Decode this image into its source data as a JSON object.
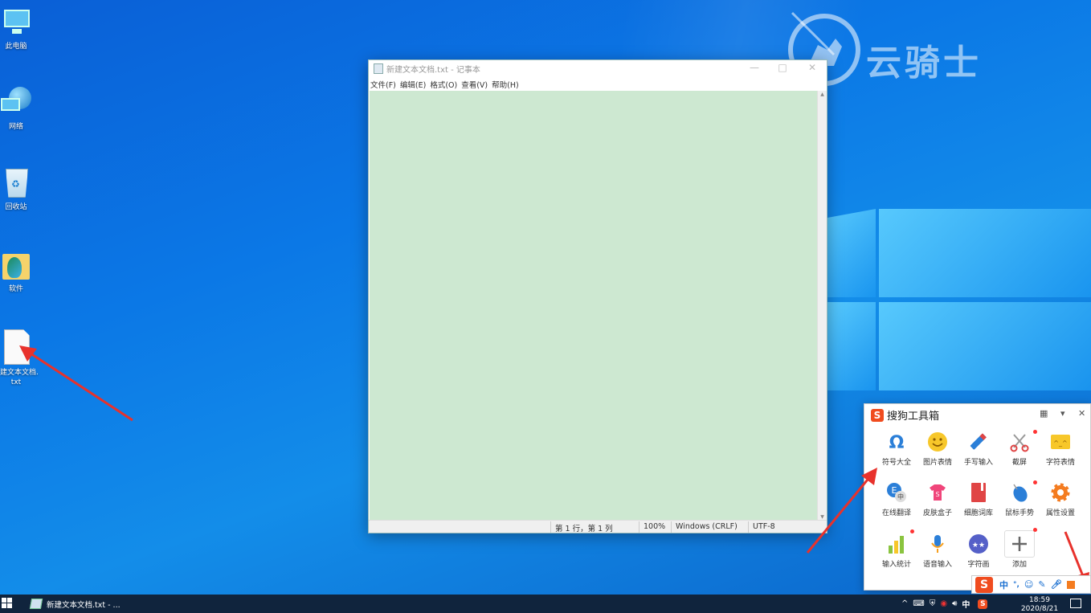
{
  "desktop": {
    "icons": [
      {
        "label": "此电脑"
      },
      {
        "label": "网络"
      },
      {
        "label": "回收站"
      },
      {
        "label": "软件"
      },
      {
        "label_line1": "建文本文档.",
        "label_line2": "txt"
      }
    ]
  },
  "watermark": {
    "text": "云骑士"
  },
  "notepad": {
    "title": "新建文本文档.txt - 记事本",
    "menu": [
      "文件(F)",
      "编辑(E)",
      "格式(O)",
      "查看(V)",
      "帮助(H)"
    ],
    "status": {
      "position": "第 1 行，第 1 列",
      "zoom": "100%",
      "line_ending": "Windows (CRLF)",
      "encoding": "UTF-8"
    },
    "editor_bg": "#cde8d1"
  },
  "toolbox": {
    "title": "搜狗工具箱",
    "items": [
      {
        "label": "符号大全",
        "icon": "omega-icon",
        "color": "#2b7fd8"
      },
      {
        "label": "图片表情",
        "icon": "smiley-icon",
        "color": "#f7c72a"
      },
      {
        "label": "手写输入",
        "icon": "pen-icon",
        "color": "#2b7fd8"
      },
      {
        "label": "截屏",
        "icon": "scissors-icon",
        "color": "#e04545"
      },
      {
        "label": "字符表情",
        "icon": "emoticon-icon",
        "color": "#f7c72a"
      },
      {
        "label": "在线翻译",
        "icon": "translate-icon",
        "color": "#2b7fd8"
      },
      {
        "label": "皮肤盒子",
        "icon": "shirt-icon",
        "color": "#f0457a"
      },
      {
        "label": "细胞词库",
        "icon": "book-icon",
        "color": "#e04545"
      },
      {
        "label": "鼠标手势",
        "icon": "mouse-icon",
        "color": "#2b7fd8"
      },
      {
        "label": "属性设置",
        "icon": "gear-icon",
        "color": "#f47c20"
      },
      {
        "label": "输入统计",
        "icon": "bar-chart-icon",
        "color": "#8ac43f"
      },
      {
        "label": "语音输入",
        "icon": "mic-icon",
        "color": "#f7a01f"
      },
      {
        "label": "字符画",
        "icon": "face-icon",
        "color": "#5560c8"
      },
      {
        "label": "添加",
        "icon": "plus-icon",
        "color": "#666666"
      }
    ]
  },
  "ime": {
    "mode": "中",
    "punct": "°,"
  },
  "taskbar": {
    "task_label": "新建文本文档.txt - ...",
    "ime_indicator": "中",
    "time": "18:59",
    "date": "2020/8/21"
  }
}
